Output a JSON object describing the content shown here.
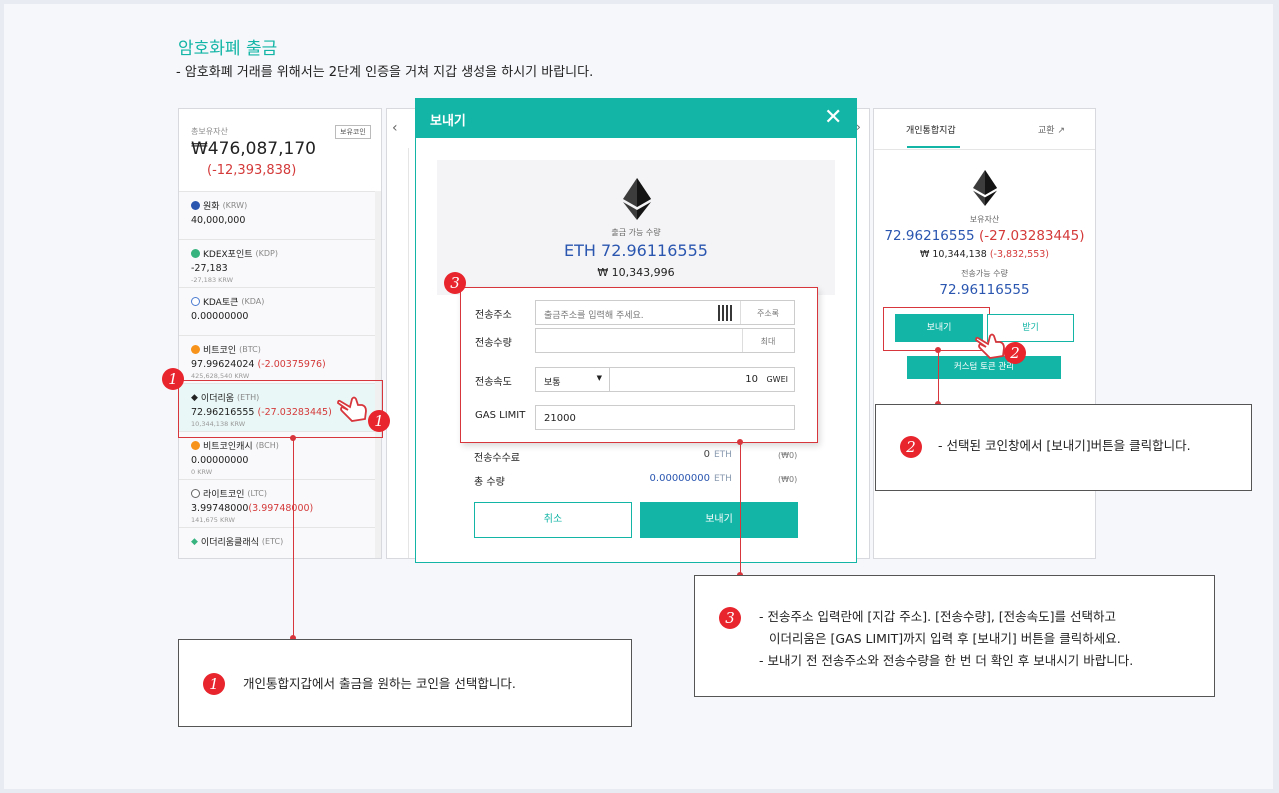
{
  "page": {
    "title": "암호화폐 출금",
    "subtitle": "- 암호화폐 거래를 위해서는 2단계 인증을 거쳐 지갑 생성을 하시기 바랍니다."
  },
  "left_panel": {
    "total_label": "총보유자산",
    "badge": "보유코인",
    "total_value": "₩476,087,170",
    "total_change": "(-12,393,838)",
    "coins": [
      {
        "name": "원화",
        "code": "(KRW)",
        "value": "40,000,000",
        "change": "",
        "sub": ""
      },
      {
        "name": "KDEX포인트",
        "code": "(KDP)",
        "value": "-27,183",
        "change": "",
        "sub": "-27,183 KRW"
      },
      {
        "name": "KDA토큰",
        "code": "(KDA)",
        "value": "0.00000000",
        "change": "",
        "sub": ""
      },
      {
        "name": "비트코인",
        "code": "(BTC)",
        "value": "97.99624024",
        "change": "(-2.00375976)",
        "sub": "425,628,540 KRW"
      },
      {
        "name": "이더리움",
        "code": "(ETH)",
        "value": "72.96216555",
        "change": "(-27.03283445)",
        "sub": "10,344,138 KRW"
      },
      {
        "name": "비트코인캐시",
        "code": "(BCH)",
        "value": "0.00000000",
        "change": "",
        "sub": "0 KRW"
      },
      {
        "name": "라이트코인",
        "code": "(LTC)",
        "value": "3.99748000",
        "change": "(3.99748000)",
        "sub": "141,675 KRW"
      },
      {
        "name": "이더리움클래식",
        "code": "(ETC)",
        "value": "",
        "change": "",
        "sub": ""
      }
    ]
  },
  "modal": {
    "title": "보내기",
    "available_label": "출금 가능 수량",
    "available_value": "ETH 72.96116555",
    "available_krw": "₩ 10,343,996",
    "address_label": "전송주소",
    "address_placeholder": "출금주소를 입력해 주세요.",
    "address_book": "주소록",
    "amount_label": "전송수량",
    "max_label": "최대",
    "speed_label": "전송속도",
    "speed_option": "보통",
    "gwei_value": "10",
    "gwei_unit": "GWEI",
    "gas_label": "GAS LIMIT",
    "gas_value": "21000",
    "fee_label": "전송수수료",
    "fee_value": "0",
    "fee_unit": "ETH",
    "fee_krw": "(₩0)",
    "total_label": "총 수량",
    "total_value": "0.00000000",
    "total_unit": "ETH",
    "total_krw": "(₩0)",
    "cancel": "취소",
    "send": "보내기"
  },
  "right_panel": {
    "tab_wallet": "개인통합지갑",
    "tab_exchange": "교환",
    "holding_label": "보유자산",
    "holding_value": "72.96216555",
    "holding_change": "(-27.03283445)",
    "holding_krw": "₩ 10,344,138",
    "holding_krw_change": "(-3,832,553)",
    "sendable_label": "전송가능 수량",
    "sendable_value": "72.96116555",
    "send_btn": "보내기",
    "receive_btn": "받기",
    "custom_btn": "커스텀 토큰 관리"
  },
  "callouts": {
    "c1": {
      "num": "1",
      "text": "개인통합지갑에서 출금을 원하는 코인을 선택합니다."
    },
    "c2": {
      "num": "2",
      "text": "- 선택된 코인창에서 [보내기]버튼을 클릭합니다."
    },
    "c3": {
      "num": "3",
      "line1": "- 전송주소 입력란에 [지갑 주소]. [전송수량], [전송속도]를 선택하고",
      "line2": "이더리움은 [GAS LIMIT]까지 입력 후 [보내기] 버튼을 클릭하세요.",
      "line3": "- 보내기 전 전송주소와 전송수량을 한 번 더 확인 후 보내시기 바랍니다."
    }
  },
  "colors": {
    "accent": "#13b5a6",
    "negative": "#d43a3a",
    "link": "#2a56b0",
    "callout": "#e8242d"
  }
}
